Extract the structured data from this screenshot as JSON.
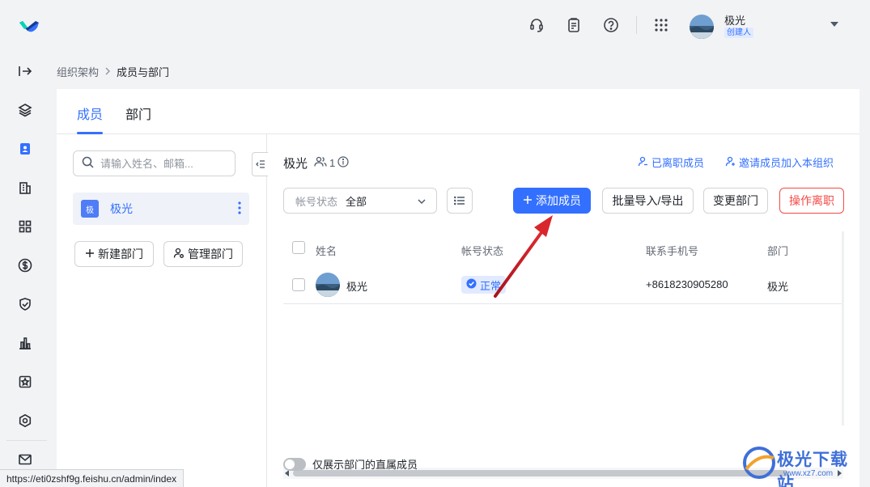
{
  "header": {
    "user_name": "极光",
    "user_role": "创建人",
    "icons": [
      "headset-icon",
      "clipboard-icon",
      "help-icon",
      "app-grid-icon"
    ]
  },
  "rail": {
    "icons": [
      "expand-icon",
      "layers-icon",
      "contacts-icon",
      "building-icon",
      "apps-icon",
      "dollar-icon",
      "shield-icon",
      "chart-icon",
      "award-icon",
      "settings-icon",
      "mail-icon"
    ]
  },
  "breadcrumb": {
    "parent": "组织架构",
    "current": "成员与部门"
  },
  "tabs": [
    {
      "label": "成员"
    },
    {
      "label": "部门"
    }
  ],
  "left": {
    "search_placeholder": "请输入姓名、邮箱...",
    "org_logo_text": "极",
    "org_name": "极光",
    "new_dept_label": "新建部门",
    "manage_dept_label": "管理部门"
  },
  "right": {
    "org_title": "极光",
    "member_count": "1",
    "resigned_link": "已离职成员",
    "invite_link": "邀请成员加入本组织",
    "status_filter": {
      "label": "帐号状态",
      "value": "全部"
    },
    "add_member_label": "添加成员",
    "batch_label": "批量导入/导出",
    "change_dept_label": "变更部门",
    "resign_label": "操作离职"
  },
  "table": {
    "columns": [
      "姓名",
      "帐号状态",
      "联系手机号",
      "部门"
    ],
    "rows": [
      {
        "name": "极光",
        "status": "正常",
        "phone": "+8618230905280",
        "dept": "极光"
      }
    ]
  },
  "footer": {
    "toggle_label": "仅展示部门的直属成员",
    "status_url": "https://eti0zshf9g.feishu.cn/admin/index"
  },
  "watermark": {
    "text": "极光下载站",
    "sub": "www.xz7.com"
  },
  "colors": {
    "accent": "#3370ff",
    "danger": "#f54a45",
    "annotation": "#d9262c"
  }
}
